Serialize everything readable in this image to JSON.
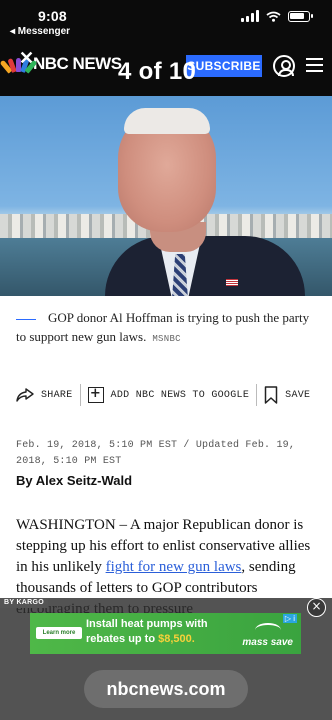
{
  "status": {
    "time": "9:08",
    "back": "◂ Messenger"
  },
  "header": {
    "brand": "NBC NEWS",
    "slide_counter": "4 of 10",
    "subscribe_label": "SUBSCRIBE",
    "icons": [
      "close-icon",
      "account-icon",
      "menu-icon"
    ],
    "colors": {
      "background": "#0b0b0b",
      "subscribe": "#2b6bff"
    }
  },
  "hero": {
    "caption": "GOP donor Al Hoffman is trying to push the party to support new gun laws.",
    "credit": "MSNBC"
  },
  "share": {
    "share_label": "SHARE",
    "google_label": "ADD NBC NEWS TO GOOGLE",
    "save_label": "SAVE"
  },
  "article": {
    "dateline": "Feb. 19, 2018, 5:10 PM EST / Updated Feb. 19, 2018, 5:10 PM EST",
    "byline": "By Alex Seitz-Wald",
    "body_lead": "WASHINGTON – A major Republican donor is stepping up his effort to enlist conservative allies in his unlikely ",
    "body_link": "fight for new gun laws",
    "body_rest": ", sending thousands of letters to GOP contributors encouraging them to pressure",
    "link_color": "#2b5fd9"
  },
  "ad": {
    "provider": "BY KARGO",
    "close": "×",
    "learn_more": "Learn more",
    "headline_1": "Install heat pumps with",
    "headline_2": "rebates up to ",
    "headline_amount": "$8,500.",
    "advertiser": "mass save",
    "ad_choices": "▷ i"
  },
  "browser": {
    "url": "nbcnews.com"
  }
}
